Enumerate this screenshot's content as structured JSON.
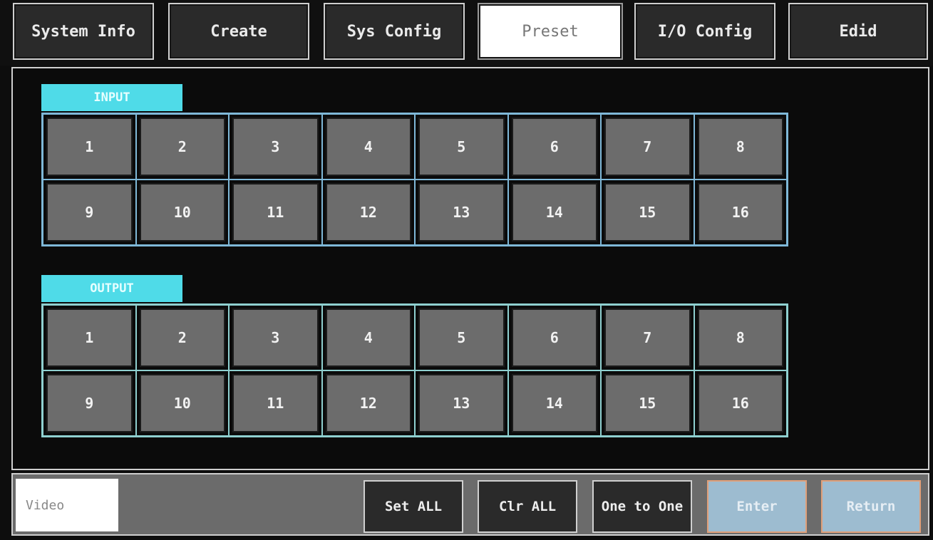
{
  "tabs": [
    {
      "label": "System Info"
    },
    {
      "label": "Create"
    },
    {
      "label": "Sys Config"
    },
    {
      "label": "Preset"
    },
    {
      "label": "I/O Config"
    },
    {
      "label": "Edid"
    }
  ],
  "active_tab": "Preset",
  "input": {
    "label": "INPUT",
    "buttons": [
      "1",
      "2",
      "3",
      "4",
      "5",
      "6",
      "7",
      "8",
      "9",
      "10",
      "11",
      "12",
      "13",
      "14",
      "15",
      "16"
    ]
  },
  "output": {
    "label": "OUTPUT",
    "buttons": [
      "1",
      "2",
      "3",
      "4",
      "5",
      "6",
      "7",
      "8",
      "9",
      "10",
      "11",
      "12",
      "13",
      "14",
      "15",
      "16"
    ]
  },
  "bottom": {
    "video_label": "Video",
    "set_all": "Set ALL",
    "clr_all": "Clr ALL",
    "one_to_one": "One to One",
    "enter": "Enter",
    "return": "Return"
  },
  "colors": {
    "section_label_bg": "#4fdbe8",
    "button_gray": "#6c6c6c",
    "disabled_button": "#9dbcd0"
  }
}
